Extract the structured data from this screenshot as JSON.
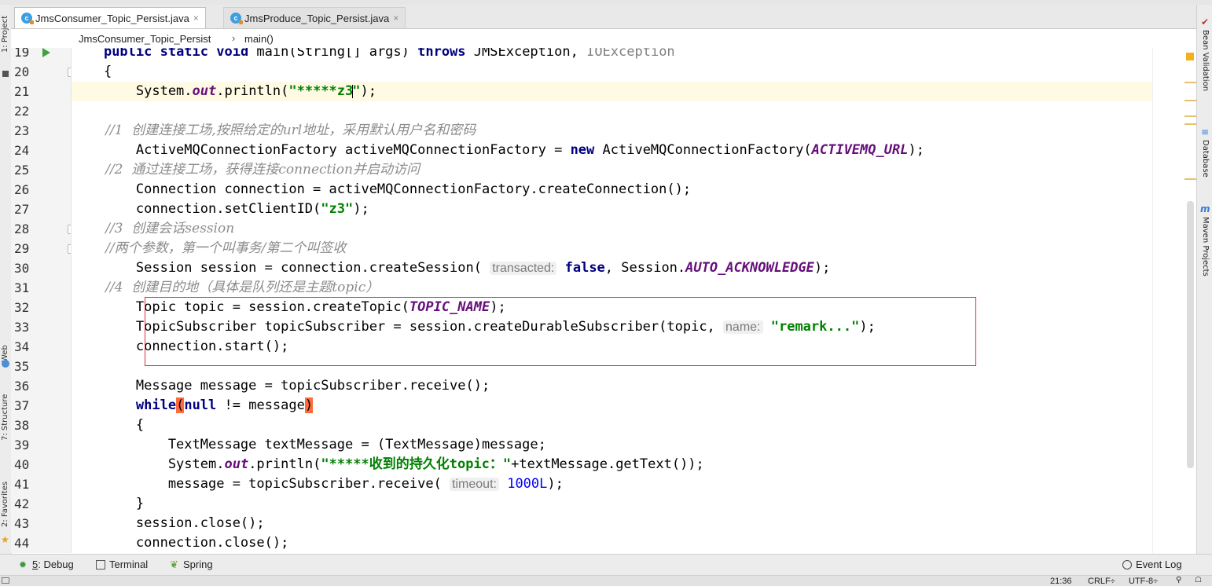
{
  "left_tools": {
    "project": "1: Project",
    "web": "Web",
    "structure": "7: Structure",
    "favorites": "2: Favorites"
  },
  "right_tools": {
    "bean_validation": "Bean Validation",
    "database": "Database",
    "maven": "Maven Projects"
  },
  "tabs": [
    {
      "label": "JmsConsumer_Topic_Persist.java",
      "active": true
    },
    {
      "label": "JmsProduce_Topic_Persist.java",
      "active": false
    }
  ],
  "breadcrumb": {
    "class_name": "JmsConsumer_Topic_Persist",
    "separator": "›",
    "method": "main()"
  },
  "editor": {
    "caret_line": 21,
    "line_numbers": [
      "19",
      "20",
      "21",
      "22",
      "23",
      "24",
      "25",
      "26",
      "27",
      "28",
      "29",
      "30",
      "31",
      "32",
      "33",
      "34",
      "35",
      "36",
      "37",
      "38",
      "39",
      "40",
      "41",
      "42",
      "43",
      "44"
    ],
    "code": {
      "l19_pre": "    ",
      "l19_kw": "public static void",
      "l19_rest": " main(String[] args) ",
      "l19_throws": "throws",
      "l19_ex": " JMSException, ",
      "l19_ex2": "IOException",
      "l20": "    {",
      "l21_a": "        System.",
      "l21_out": "out",
      "l21_b": ".println(",
      "l21_str1": "\"*****z3",
      "l21_str2": "\"",
      "l21_c": ");",
      "l23": "        //1  创建连接工场,按照给定的url地址，采用默认用户名和密码",
      "l24_a": "        ActiveMQConnectionFactory activeMQConnectionFactory = ",
      "l24_new": "new",
      "l24_b": " ActiveMQConnectionFactory(",
      "l24_const": "ACTIVEMQ_URL",
      "l24_c": ");",
      "l25": "        //2  通过连接工场，获得连接connection并启动访问",
      "l26": "        Connection connection = activeMQConnectionFactory.createConnection();",
      "l27_a": "        connection.setClientID(",
      "l27_str": "\"z3\"",
      "l27_b": ");",
      "l28": "        //3  创建会话session",
      "l29": "        //两个参数，第一个叫事务/第二个叫签收",
      "l30_a": "        Session session = connection.createSession( ",
      "l30_hint": "transacted:",
      "l30_false": " false",
      "l30_b": ", Session.",
      "l30_const": "AUTO_ACKNOWLEDGE",
      "l30_c": ");",
      "l31": "        //4  创建目的地（具体是队列还是主题topic）",
      "l32_a": "        Topic topic = session.createTopic(",
      "l32_const": "TOPIC_NAME",
      "l32_b": ");",
      "l33_a": "        TopicSubscriber topicSubscriber = session.createDurableSubscriber(topic, ",
      "l33_hint": "name:",
      "l33_str": " \"remark...\"",
      "l33_b": ");",
      "l34": "        connection.start();",
      "l36": "        Message message = topicSubscriber.receive();",
      "l37_a": "        ",
      "l37_while": "while",
      "l37_open": "(",
      "l37_null": "null",
      "l37_b": " != message",
      "l37_close": ")",
      "l38": "        {",
      "l39": "            TextMessage textMessage = (TextMessage)message;",
      "l40_a": "            System.",
      "l40_out": "out",
      "l40_b": ".println(",
      "l40_str": "\"*****收到的持久化topic：\"",
      "l40_c": "+textMessage.getText());",
      "l41_a": "            message = topicSubscriber.receive( ",
      "l41_hint": "timeout:",
      "l41_num": " 1000L",
      "l41_b": ");",
      "l42": "        }",
      "l43": "        session.close();",
      "l44": "        connection.close();"
    }
  },
  "bottom_tools": {
    "debug_num": "5",
    "debug": ": Debug",
    "terminal": "Terminal",
    "spring": "Spring",
    "event_log": "Event Log"
  },
  "status": {
    "position": "21:36",
    "line_sep": "CRLF÷",
    "encoding": "UTF-8÷"
  }
}
